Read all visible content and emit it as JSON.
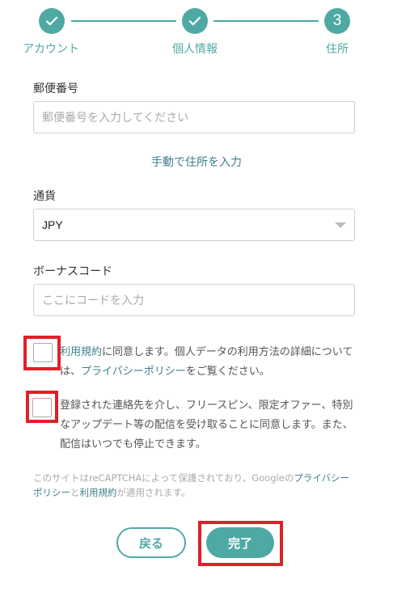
{
  "stepper": {
    "steps": [
      {
        "label": "アカウント",
        "state": "done"
      },
      {
        "label": "個人情報",
        "state": "done"
      },
      {
        "label": "住所",
        "state": "current",
        "number": "3"
      }
    ],
    "accent": "#4fa9a3"
  },
  "form": {
    "postal": {
      "label": "郵便番号",
      "placeholder": "郵便番号を入力してください"
    },
    "manual_address_link": "手動で住所を入力",
    "currency": {
      "label": "通貨",
      "value": "JPY"
    },
    "bonus": {
      "label": "ボーナスコード",
      "placeholder": "ここにコードを入力"
    }
  },
  "consent": {
    "terms": {
      "link1": "利用規約",
      "text1": "に同意します。個人データの利用方法の詳細について",
      "text2": "は、",
      "link2": "プライバシーポリシー",
      "text3": "をご覧ください。"
    },
    "marketing": {
      "text": "登録された連絡先を介し、フリースピン、限定オファー、特別なアップデート等の配信を受け取ることに同意します。また、配信はいつでも停止できます。"
    }
  },
  "captcha": {
    "text1": "このサイトはreCAPTCHAによって保護されており、Googleの",
    "link1": "プライバシーポリシー",
    "text2": "と",
    "link2": "利用規約",
    "text3": "が適用されます。"
  },
  "buttons": {
    "back": "戻る",
    "done": "完了"
  },
  "highlight_color": "#e0202a"
}
